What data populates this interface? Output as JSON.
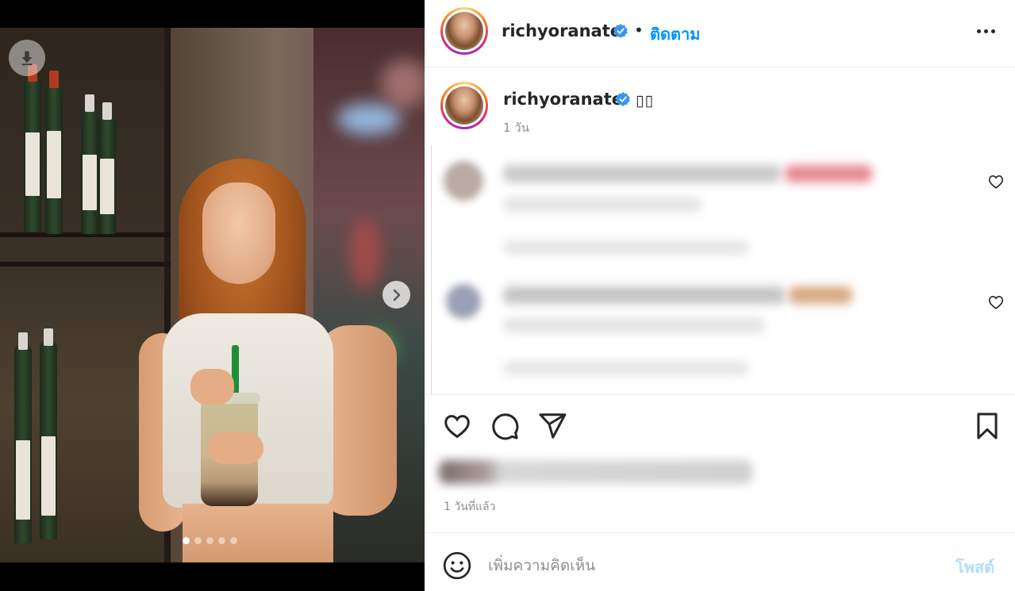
{
  "post": {
    "username": "richyoranate",
    "verified": true,
    "follow_label": "ติดตาม",
    "separator": "•",
    "caption": "▯▯",
    "caption_time": "1 วัน",
    "posted_ago": "1 วันที่แล้ว"
  },
  "carousel": {
    "total_slides": 5,
    "active_index": 0
  },
  "comment_box": {
    "placeholder": "เพิ่มความคิดเห็น",
    "post_label": "โพสต์"
  },
  "colors": {
    "accent_blue": "#0095f6",
    "post_disabled": "#b2dffc",
    "verified_blue": "#3897f0",
    "text": "#262626",
    "muted": "#8e8e8e"
  },
  "icons": {
    "download": "download-icon",
    "next": "chevron-right-icon",
    "more": "more-horizontal-icon",
    "like": "heart-icon",
    "comment": "comment-icon",
    "share": "paper-plane-icon",
    "save": "bookmark-icon",
    "emoji": "emoji-icon"
  }
}
